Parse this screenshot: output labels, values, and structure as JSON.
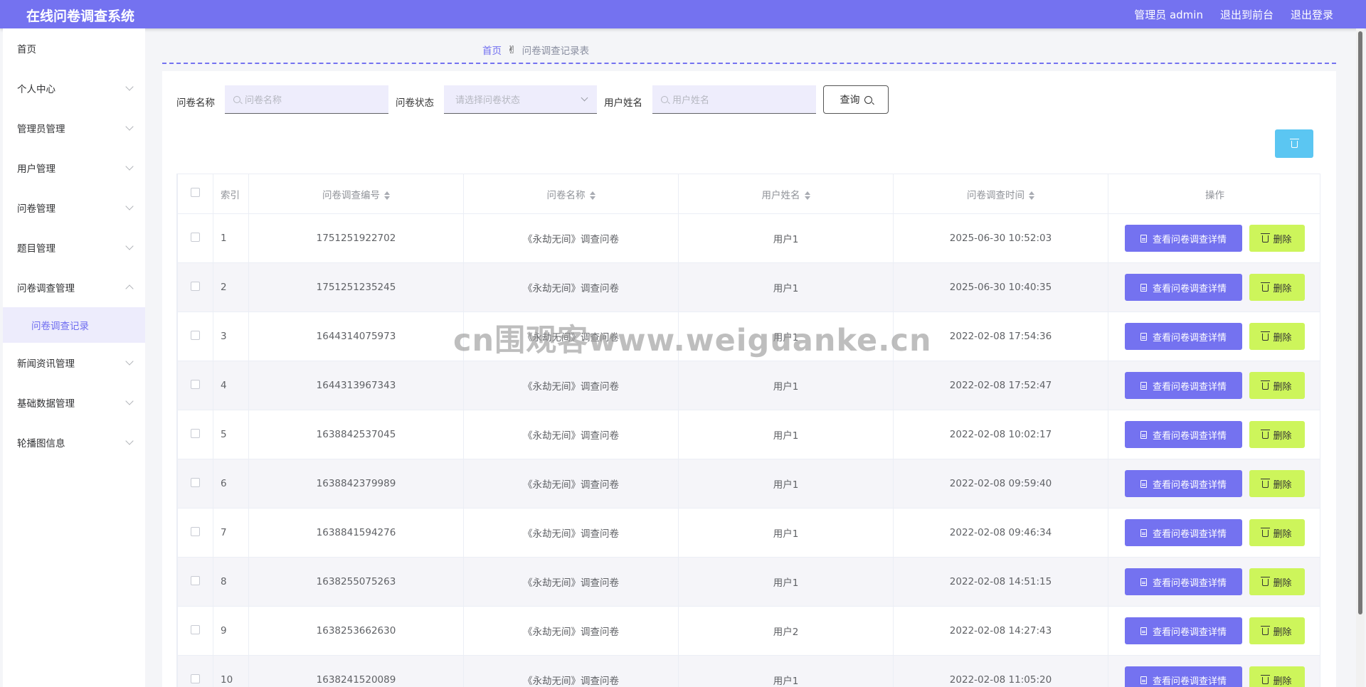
{
  "app": {
    "title": "在线问卷调查系统",
    "admin_label": "管理员 admin",
    "to_front": "退出到前台",
    "logout": "退出登录"
  },
  "colors": {
    "primary": "#7472f0",
    "delete": "#cdf55b",
    "batch_delete": "#5bc6f2"
  },
  "sidebar": {
    "items": [
      {
        "label": "首页",
        "expandable": false
      },
      {
        "label": "个人中心",
        "expandable": true
      },
      {
        "label": "管理员管理",
        "expandable": true
      },
      {
        "label": "用户管理",
        "expandable": true
      },
      {
        "label": "问卷管理",
        "expandable": true
      },
      {
        "label": "题目管理",
        "expandable": true
      },
      {
        "label": "问卷调查管理",
        "expandable": true,
        "open": true
      },
      {
        "label": "新闻资讯管理",
        "expandable": true
      },
      {
        "label": "基础数据管理",
        "expandable": true
      },
      {
        "label": "轮播图信息",
        "expandable": true
      }
    ],
    "sub_item": "问卷调查记录"
  },
  "breadcrumb": {
    "home": "首页",
    "current": "问卷调查记录表"
  },
  "filters": {
    "name_label": "问卷名称",
    "name_placeholder": "问卷名称",
    "status_label": "问卷状态",
    "status_placeholder": "请选择问卷状态",
    "user_label": "用户姓名",
    "user_placeholder": "用户姓名",
    "query_label": "查询"
  },
  "table": {
    "headers": {
      "index": "索引",
      "code": "问卷调查编号",
      "name": "问卷名称",
      "user": "用户姓名",
      "time": "问卷调查时间",
      "ops": "操作"
    },
    "view_label": "查看问卷调查详情",
    "delete_label": "删除",
    "rows": [
      {
        "index": "1",
        "code": "1751251922702",
        "name": "《永劫无间》调查问卷",
        "user": "用户1",
        "time": "2025-06-30 10:52:03"
      },
      {
        "index": "2",
        "code": "1751251235245",
        "name": "《永劫无间》调查问卷",
        "user": "用户1",
        "time": "2025-06-30 10:40:35"
      },
      {
        "index": "3",
        "code": "1644314075973",
        "name": "《永劫无间》调查问卷",
        "user": "用户1",
        "time": "2022-02-08 17:54:36"
      },
      {
        "index": "4",
        "code": "1644313967343",
        "name": "《永劫无间》调查问卷",
        "user": "用户1",
        "time": "2022-02-08 17:52:47"
      },
      {
        "index": "5",
        "code": "1638842537045",
        "name": "《永劫无间》调查问卷",
        "user": "用户1",
        "time": "2022-02-08 10:02:17"
      },
      {
        "index": "6",
        "code": "1638842379989",
        "name": "《永劫无间》调查问卷",
        "user": "用户1",
        "time": "2022-02-08 09:59:40"
      },
      {
        "index": "7",
        "code": "1638841594276",
        "name": "《永劫无间》调查问卷",
        "user": "用户1",
        "time": "2022-02-08 09:46:34"
      },
      {
        "index": "8",
        "code": "1638255075263",
        "name": "《永劫无间》调查问卷",
        "user": "用户1",
        "time": "2022-02-08 14:51:15"
      },
      {
        "index": "9",
        "code": "1638253662630",
        "name": "《永劫无间》调查问卷",
        "user": "用户2",
        "time": "2022-02-08 14:27:43"
      },
      {
        "index": "10",
        "code": "1638241520089",
        "name": "《永劫无间》调查问卷",
        "user": "用户1",
        "time": "2022-02-08 11:05:20"
      }
    ]
  },
  "watermark": "cn围观客www.weiguanke.cn"
}
